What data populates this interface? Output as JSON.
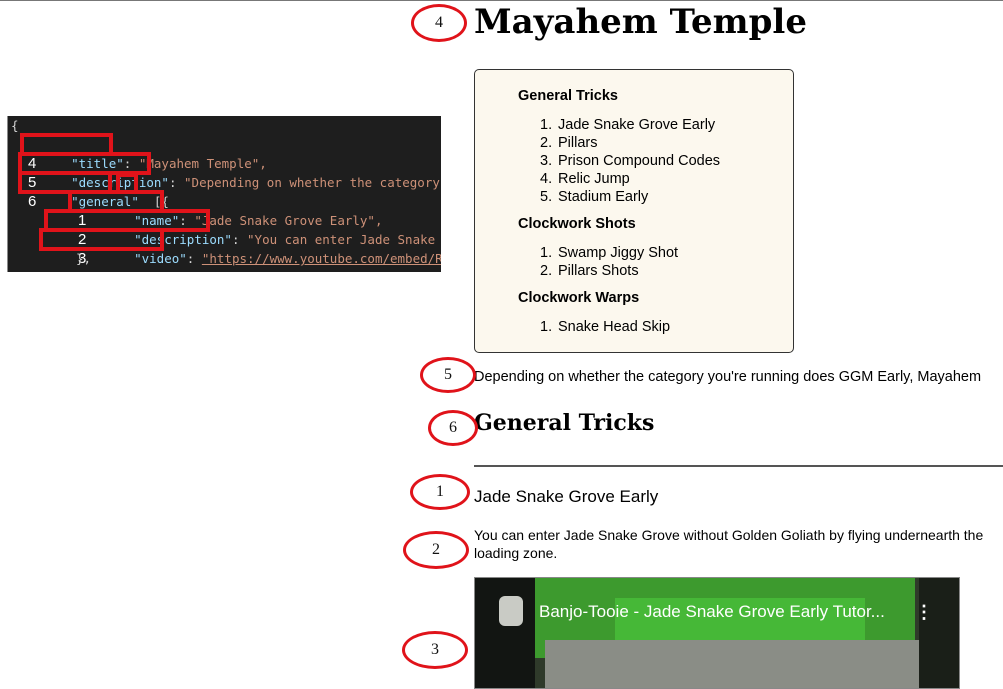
{
  "code": {
    "lines": [
      {
        "num": "4",
        "key": "\"title\"",
        "sep": ": ",
        "value": "\"Mayahem Temple\","
      },
      {
        "num": "5",
        "key": "\"description\"",
        "sep": ": ",
        "value": "\"Depending on whether the category yo"
      },
      {
        "num": "6",
        "key": "\"general\"",
        "sep": ": ",
        "value": "[{"
      },
      {
        "num": "1",
        "key": "\"name\"",
        "sep": ": ",
        "value": "\"Jade Snake Grove Early\","
      },
      {
        "num": "2",
        "key": "\"description\"",
        "sep": ": ",
        "value": "\"You can enter Jade Snake Gro"
      },
      {
        "num": "3",
        "key": "\"video\"",
        "sep": ": ",
        "value": "\"https://www.youtube.com/embed/RaXh"
      }
    ],
    "open_brace": "{",
    "close_brace": "},"
  },
  "page": {
    "title": "Mayahem Temple",
    "toc": {
      "sections": [
        {
          "heading": "General Tricks",
          "items": [
            "Jade Snake Grove Early",
            "Pillars",
            "Prison Compound Codes",
            "Relic Jump",
            "Stadium Early"
          ]
        },
        {
          "heading": "Clockwork Shots",
          "items": [
            "Swamp Jiggy Shot",
            "Pillars Shots"
          ]
        },
        {
          "heading": "Clockwork Warps",
          "items": [
            "Snake Head Skip"
          ]
        }
      ]
    },
    "description": "Depending on whether the category you're running does GGM Early, Mayahem",
    "section_heading": "General Tricks",
    "trick": {
      "name": "Jade Snake Grove Early",
      "description": "You can enter Jade Snake Grove without Golden Goliath by flying undernearth the loading zone."
    },
    "video": {
      "title": "Banjo-Tooie - Jade Snake Grove Early Tutor...",
      "menu": "⋮"
    }
  },
  "annotations": {
    "ovals": [
      "4",
      "5",
      "6",
      "1",
      "2",
      "3"
    ]
  },
  "colors": {
    "annotation_red": "#e0131a",
    "toc_background": "#fcf8ee",
    "editor_background": "#1e1e1e",
    "json_key": "#9cdcfe",
    "json_string": "#ce9178"
  }
}
